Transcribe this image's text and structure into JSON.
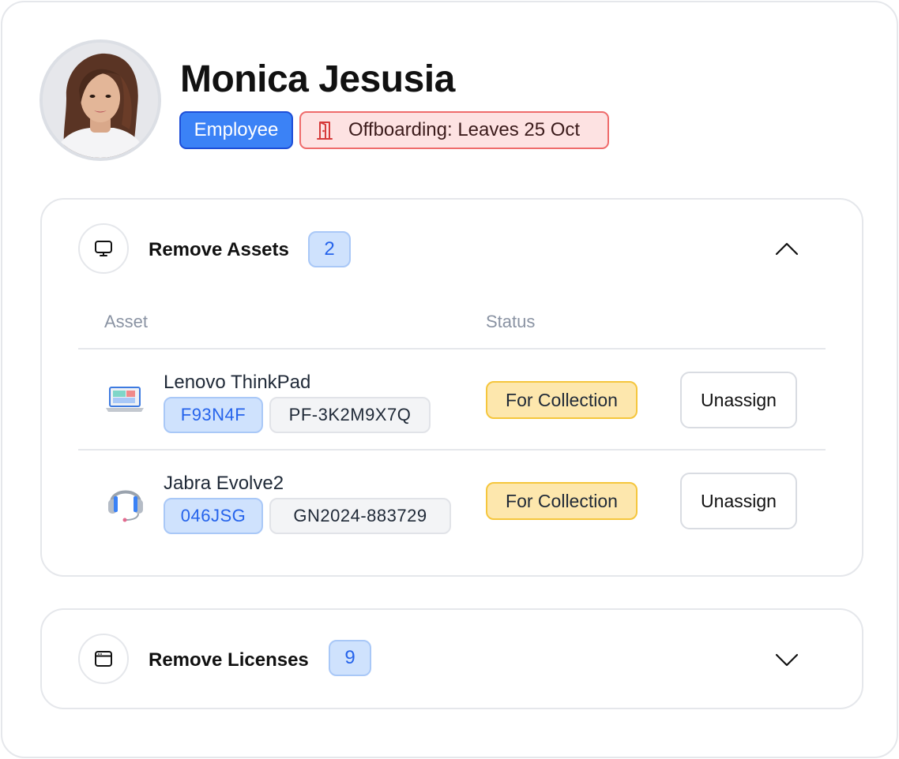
{
  "profile": {
    "name": "Monica Jesusia",
    "role_badge": "Employee",
    "offboarding_badge": "Offboarding: Leaves 25 Oct"
  },
  "assets_section": {
    "title": "Remove Assets",
    "count": "2",
    "expanded": true,
    "columns": {
      "asset": "Asset",
      "status": "Status"
    },
    "rows": [
      {
        "icon": "laptop-icon",
        "name": "Lenovo ThinkPad",
        "asset_tag": "F93N4F",
        "serial": "PF-3K2M9X7Q",
        "status": "For Collection",
        "action": "Unassign"
      },
      {
        "icon": "headset-icon",
        "name": "Jabra Evolve2",
        "asset_tag": "046JSG",
        "serial": "GN2024-883729",
        "status": "For Collection",
        "action": "Unassign"
      }
    ]
  },
  "licenses_section": {
    "title": "Remove Licenses",
    "count": "9",
    "expanded": false
  },
  "colors": {
    "primary": "#3b82f6",
    "danger_bg": "#fde2e2",
    "danger_border": "#ef6b6b",
    "warning_bg": "#fde7ad",
    "warning_border": "#f5c63c"
  }
}
